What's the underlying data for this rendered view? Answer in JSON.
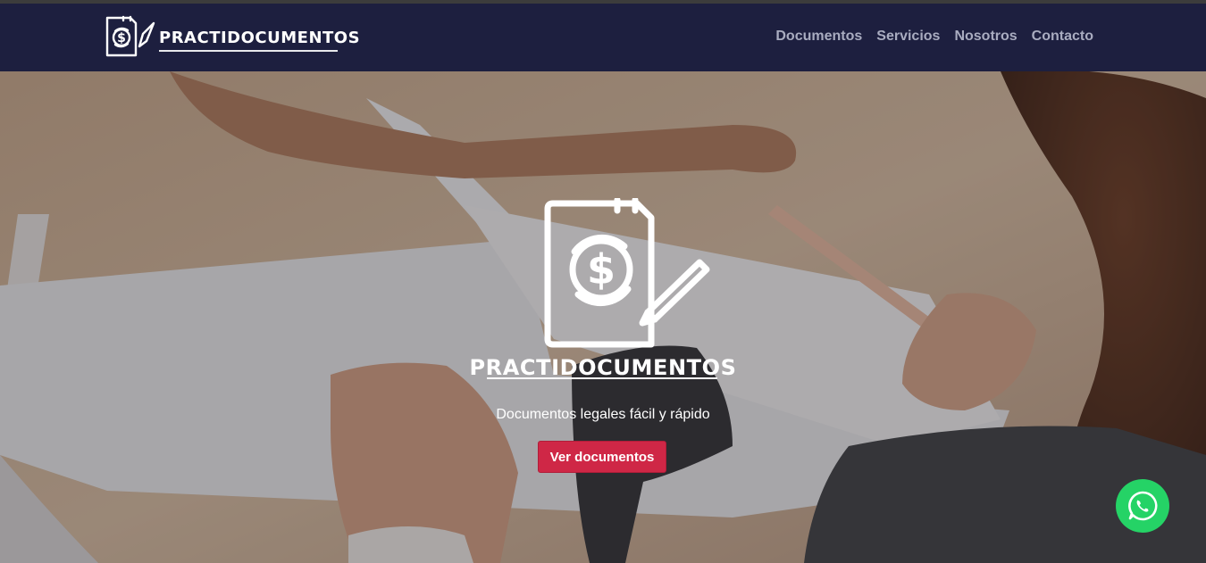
{
  "brand": {
    "name": "PRACTIDOCUMENTOS",
    "logo_icon": "document-dollar-icon"
  },
  "nav": {
    "items": [
      {
        "label": "Documentos"
      },
      {
        "label": "Servicios"
      },
      {
        "label": "Nosotros"
      },
      {
        "label": "Contacto"
      }
    ]
  },
  "hero": {
    "title": "PRACTIDOCUMENTOS",
    "tagline": "Documentos legales fácil y rápido",
    "cta_label": "Ver documentos",
    "logo_icon": "document-dollar-icon",
    "background": "office-desk-documents-photo"
  },
  "floating": {
    "whatsapp_icon": "whatsapp-icon"
  },
  "colors": {
    "navbar": "#1d1f3f",
    "nav_text": "#a9acc0",
    "cta": "#cf2746",
    "whatsapp": "#25d366"
  }
}
